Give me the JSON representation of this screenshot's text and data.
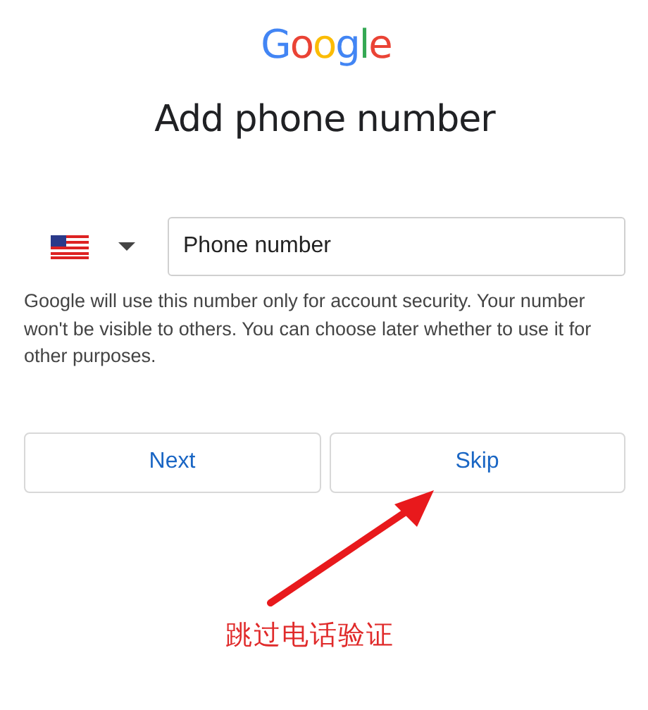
{
  "logo": "Google",
  "title": "Add phone number",
  "phone": {
    "placeholder": "Phone number"
  },
  "help": "Google will use this number only for account security. Your number won't be visible to others. You can choose later whether to use it for other purposes.",
  "buttons": [
    {
      "label": "Next"
    },
    {
      "label": "Skip"
    }
  ],
  "annotation": {
    "text": "跳过电话验证"
  }
}
